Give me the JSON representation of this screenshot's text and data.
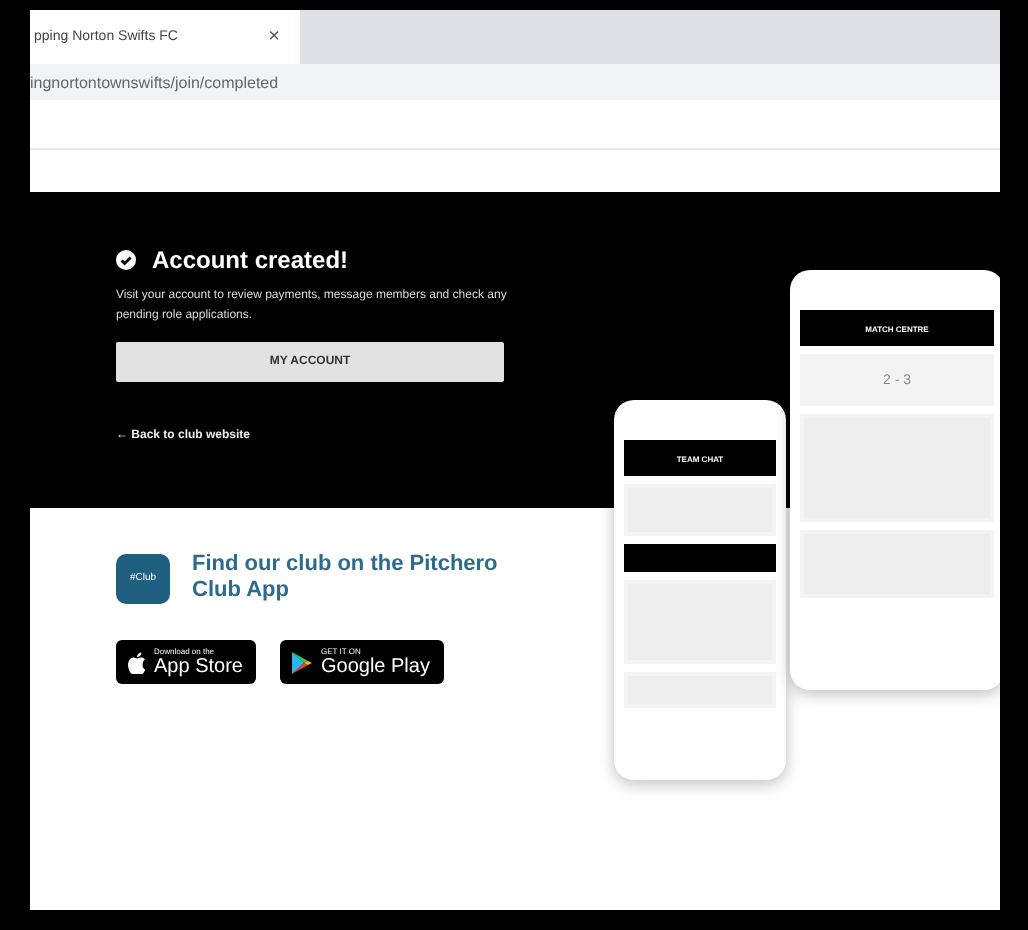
{
  "browser": {
    "tab_title": "pping Norton Swifts FC",
    "tab_close": "×",
    "url": "ingnortontownswifts/join/completed"
  },
  "hero": {
    "title": "Account created!",
    "description": "Visit your account to review payments, message members and check any pending role applications.",
    "button": "MY ACCOUNT",
    "back_link": "← Back to club website"
  },
  "mockups": {
    "back_phone_title": "TEAM CHAT",
    "front_phone_title": "MATCH CENTRE",
    "score": "2 - 3"
  },
  "app_promo": {
    "icon_text": "#Club",
    "title": "Find our club on the Pitchero Club App",
    "badges": [
      {
        "kind": "apple",
        "small": "Download on the",
        "large": "App Store"
      },
      {
        "kind": "google",
        "small": "GET IT ON",
        "large": "Google Play"
      }
    ]
  }
}
